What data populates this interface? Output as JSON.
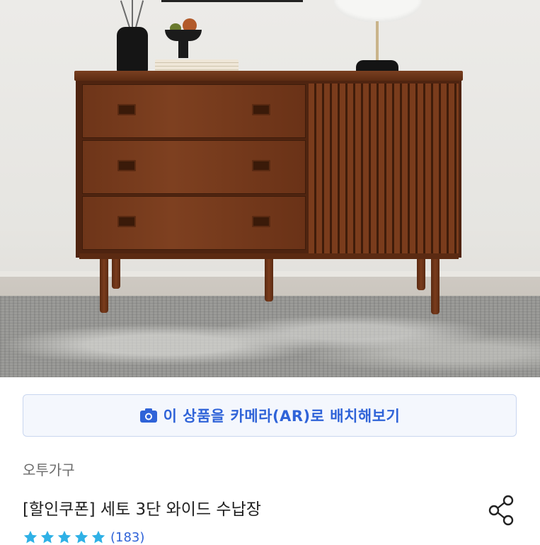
{
  "product_image": {
    "description_icon": "product-photo"
  },
  "ar_button": {
    "icon": "camera-icon",
    "label": "이 상품을 카메라(AR)로 배치해보기",
    "accent_color": "#2f63d8"
  },
  "product": {
    "brand": "오투가구",
    "title": "[할인쿠폰] 세토 3단 와이드 수납장",
    "rating_stars": 5,
    "review_count": "(183)",
    "star_color": "#2fb1e6"
  },
  "share": {
    "icon": "share-icon"
  }
}
